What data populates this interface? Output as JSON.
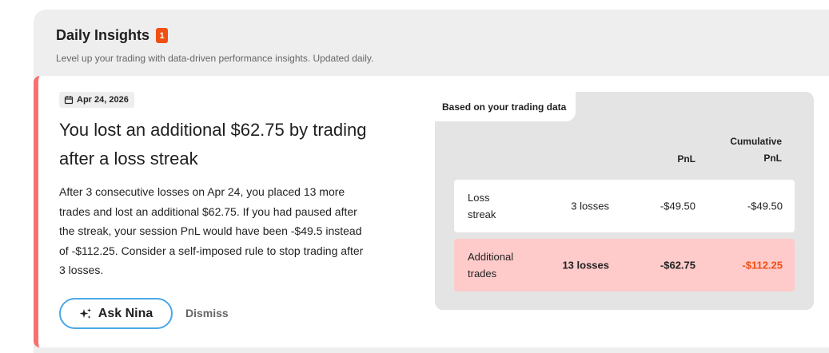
{
  "header": {
    "title": "Daily Insights",
    "badge_count": "1",
    "subtitle": "Level up your trading with data-driven performance insights. Updated daily."
  },
  "insight": {
    "date": "Apr 24, 2026",
    "headline_line1": "You lost an additional $62.75 by trading",
    "headline_line2": "after a loss streak",
    "body_line1": "After 3 consecutive losses on Apr 24, you placed 13 more",
    "body_line2": "trades and lost an additional $62.75. If you had paused after",
    "body_line3": "the streak, your session PnL would have been -$49.5 instead",
    "body_line4": "of -$112.25. Consider a self-imposed rule to stop trading after",
    "body_line5": "3 losses.",
    "ask_label": "Ask Nina",
    "dismiss_label": "Dismiss"
  },
  "data_panel": {
    "tab_label": "Based on your trading data",
    "columns": {
      "pnl": "PnL",
      "cumulative_line1": "Cumulative",
      "cumulative_line2": "PnL"
    },
    "rows": [
      {
        "label_line1": "Loss",
        "label_line2": "streak",
        "count": "3 losses",
        "pnl": "-$49.50",
        "cumulative": "-$49.50"
      },
      {
        "label_line1": "Additional",
        "label_line2": "trades",
        "count": "13 losses",
        "pnl": "-$62.75",
        "cumulative": "-$112.25"
      }
    ]
  },
  "colors": {
    "accent_border": "#f87070",
    "badge": "#f04e12",
    "button_border": "#4ba8e6",
    "highlight_row": "#fecaca",
    "negative_total": "#f04e12"
  },
  "icons": {
    "date": "calendar-icon",
    "ask": "sparkle-icon"
  }
}
